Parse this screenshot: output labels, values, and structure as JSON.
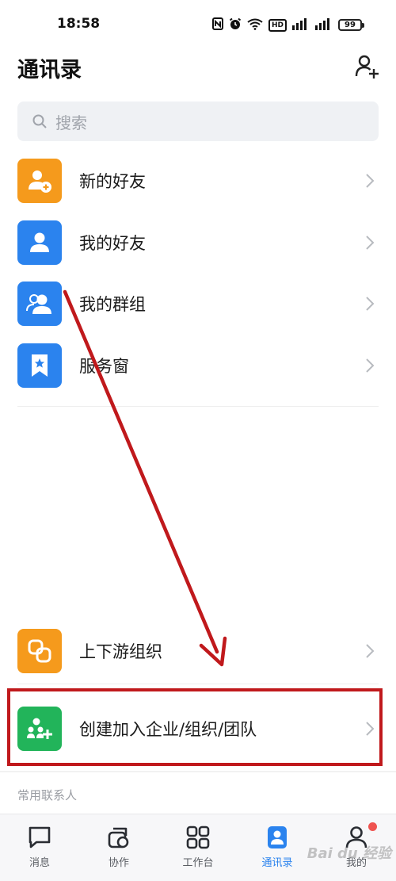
{
  "status_bar": {
    "time": "18:58",
    "icons": [
      "nfc-icon",
      "alarm-icon",
      "wifi-icon",
      "hd-icon",
      "signal-icon",
      "signal-icon"
    ],
    "hd_label": "HD",
    "battery": "99"
  },
  "header": {
    "title": "通讯录",
    "add_icon": "add-person-icon"
  },
  "search": {
    "placeholder": "搜索"
  },
  "menu": [
    {
      "label": "新的好友",
      "icon": "person-add-icon",
      "color": "#f59a1c"
    },
    {
      "label": "我的好友",
      "icon": "person-icon",
      "color": "#2b83ee"
    },
    {
      "label": "我的群组",
      "icon": "group-icon",
      "color": "#2b83ee"
    },
    {
      "label": "服务窗",
      "icon": "bookmark-star-icon",
      "color": "#2b83ee"
    }
  ],
  "org": {
    "upstream_label": "上下游组织",
    "upstream_color": "#f59a1c",
    "create_label": "创建加入企业/组织/团队",
    "create_color": "#22b45a"
  },
  "section": {
    "frequent_contacts": "常用联系人"
  },
  "tabs": [
    {
      "label": "消息",
      "icon": "message-icon",
      "active": false
    },
    {
      "label": "协作",
      "icon": "collab-icon",
      "active": false
    },
    {
      "label": "工作台",
      "icon": "grid-icon",
      "active": false
    },
    {
      "label": "通讯录",
      "icon": "contacts-icon",
      "active": true
    },
    {
      "label": "我的",
      "icon": "profile-icon",
      "active": false,
      "badge": true
    }
  ],
  "annotation": {
    "color": "#c0191c"
  },
  "watermark": "Bai du 经验"
}
